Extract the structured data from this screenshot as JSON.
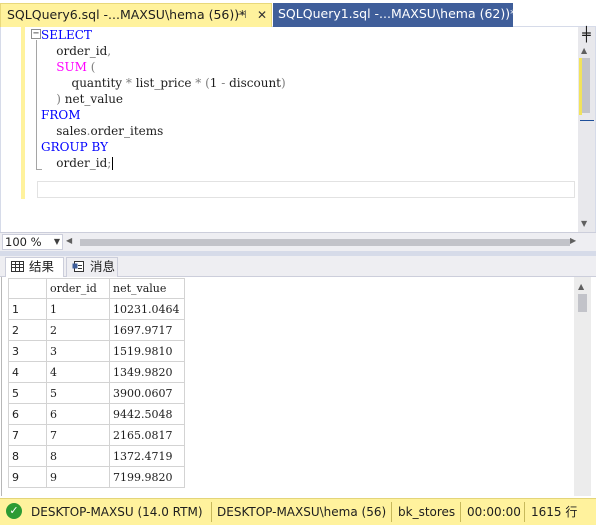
{
  "tabs": [
    {
      "label": "SQLQuery6.sql -...MAXSU\\hema (56))*",
      "pin_icon": "pin-icon",
      "close_icon": "close-icon"
    },
    {
      "label": "SQLQuery1.sql -...MAXSU\\hema (62))*"
    }
  ],
  "editor": {
    "lines": [
      {
        "parts": [
          {
            "t": "SELECT",
            "c": "kw"
          }
        ]
      },
      {
        "parts": [
          {
            "t": "    order_id",
            "c": ""
          },
          {
            "t": ",",
            "c": "op"
          }
        ]
      },
      {
        "parts": [
          {
            "t": "    ",
            "c": ""
          },
          {
            "t": "SUM",
            "c": "fn"
          },
          {
            "t": " (",
            "c": "op"
          }
        ]
      },
      {
        "parts": [
          {
            "t": "        quantity ",
            "c": ""
          },
          {
            "t": "*",
            "c": "op"
          },
          {
            "t": " list_price ",
            "c": ""
          },
          {
            "t": "*",
            "c": "op"
          },
          {
            "t": " (",
            "c": "op"
          },
          {
            "t": "1 ",
            "c": ""
          },
          {
            "t": "-",
            "c": "op"
          },
          {
            "t": " discount",
            "c": ""
          },
          {
            "t": ")",
            "c": "op"
          }
        ]
      },
      {
        "parts": [
          {
            "t": "    ",
            "c": ""
          },
          {
            "t": ")",
            "c": "op"
          },
          {
            "t": " net_value",
            "c": ""
          }
        ]
      },
      {
        "parts": [
          {
            "t": "FROM",
            "c": "kw"
          }
        ]
      },
      {
        "parts": [
          {
            "t": "    sales",
            "c": ""
          },
          {
            "t": ".",
            "c": "op"
          },
          {
            "t": "order_items",
            "c": ""
          }
        ]
      },
      {
        "parts": [
          {
            "t": "GROUP BY",
            "c": "kw"
          }
        ]
      },
      {
        "parts": [
          {
            "t": "    order_id",
            "c": ""
          },
          {
            "t": ";",
            "c": "op"
          }
        ],
        "caret": true
      }
    ],
    "fold_toggle": "−",
    "split_icon": "split-window-icon"
  },
  "zoom": {
    "value": "100 %"
  },
  "results_tabs": [
    {
      "label": "结果",
      "icon": "grid-icon"
    },
    {
      "label": "消息",
      "icon": "messages-icon"
    }
  ],
  "grid": {
    "columns": [
      "order_id",
      "net_value"
    ],
    "rows": [
      [
        "1",
        "1",
        "10231.0464"
      ],
      [
        "2",
        "2",
        "1697.9717"
      ],
      [
        "3",
        "3",
        "1519.9810"
      ],
      [
        "4",
        "4",
        "1349.9820"
      ],
      [
        "5",
        "5",
        "3900.0607"
      ],
      [
        "6",
        "6",
        "9442.5048"
      ],
      [
        "7",
        "7",
        "2165.0817"
      ],
      [
        "8",
        "8",
        "1372.4719"
      ],
      [
        "9",
        "9",
        "7199.9820"
      ]
    ]
  },
  "status": {
    "ok_icon": "success-check-icon",
    "server": "DESKTOP-MAXSU (14.0 RTM)",
    "user": "DESKTOP-MAXSU\\hema (56)",
    "database": "bk_stores",
    "elapsed": "00:00:00",
    "rows": "1615 行"
  },
  "colors": {
    "tab_active_bg": "#fff29d",
    "tab_inactive_bg": "#3f5e9a",
    "keyword": "#0000ff",
    "function": "#ff00ff",
    "operator": "#808080",
    "statusbar_bg": "#fff29d",
    "ok_green": "#2d9b34"
  }
}
